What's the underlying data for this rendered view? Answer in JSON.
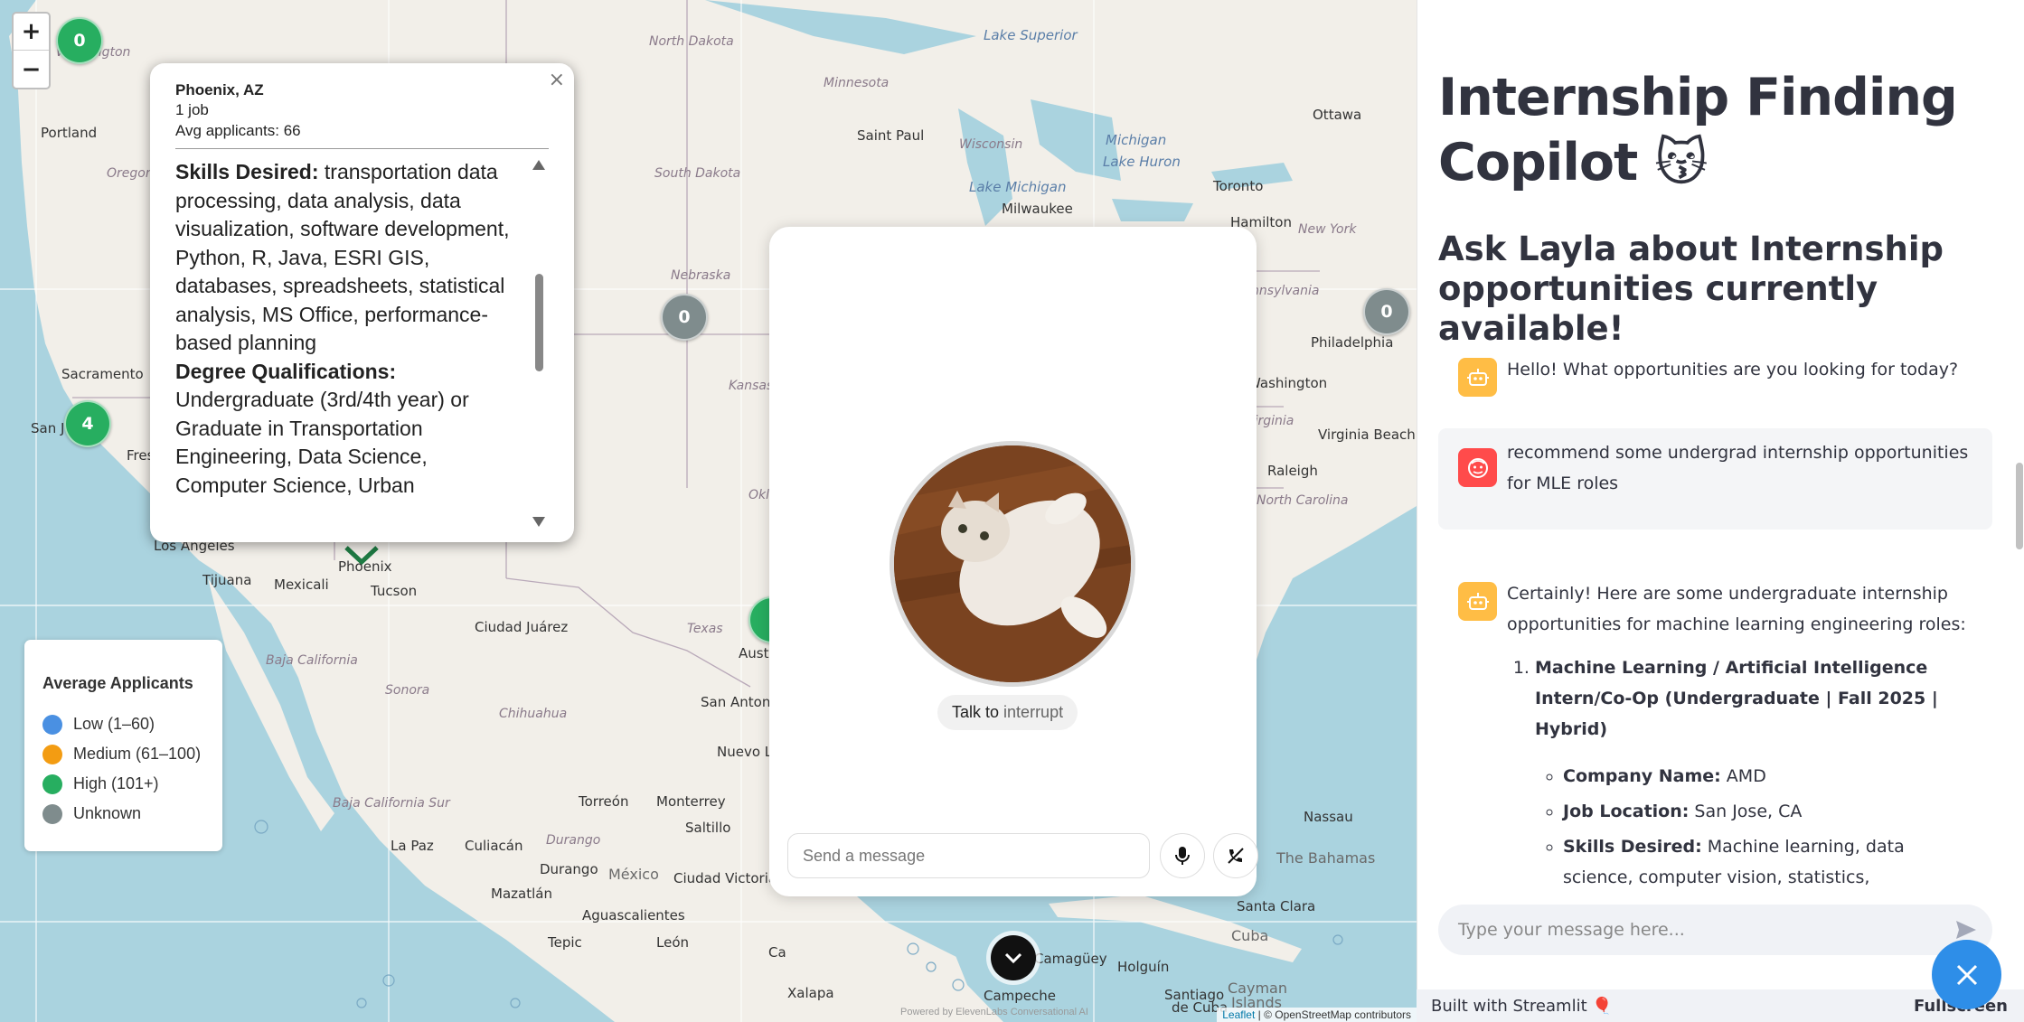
{
  "map": {
    "zoom_in": "+",
    "zoom_out": "−",
    "places": [
      {
        "name": "Washington",
        "cls": "state"
      },
      {
        "name": "North Dakota",
        "cls": "state"
      },
      {
        "name": "Lake Superior",
        "cls": "water"
      },
      {
        "name": "Minnesota",
        "cls": "state"
      },
      {
        "name": "Ottawa",
        "cls": ""
      },
      {
        "name": "Portland",
        "cls": ""
      },
      {
        "name": "Oregon",
        "cls": "state"
      },
      {
        "name": "Saint Paul",
        "cls": ""
      },
      {
        "name": "Wisconsin",
        "cls": "state"
      },
      {
        "name": "Michigan",
        "cls": "water"
      },
      {
        "name": "Lake Huron",
        "cls": "water"
      },
      {
        "name": "South Dakota",
        "cls": "state"
      },
      {
        "name": "Lake Michigan",
        "cls": "water"
      },
      {
        "name": "Toronto",
        "cls": ""
      },
      {
        "name": "Milwaukee",
        "cls": ""
      },
      {
        "name": "Hamilton",
        "cls": ""
      },
      {
        "name": "New York",
        "cls": "state"
      },
      {
        "name": "Nebraska",
        "cls": "state"
      },
      {
        "name": "Pennsylvania",
        "cls": "state"
      },
      {
        "name": "Philadelphia",
        "cls": ""
      },
      {
        "name": "Sacramento",
        "cls": ""
      },
      {
        "name": "Washington",
        "cls": ""
      },
      {
        "name": "Kansas",
        "cls": "state"
      },
      {
        "name": "San Jo",
        "cls": ""
      },
      {
        "name": "Fres",
        "cls": ""
      },
      {
        "name": "Virginia",
        "cls": "state"
      },
      {
        "name": "Virginia Beach",
        "cls": ""
      },
      {
        "name": "Raleigh",
        "cls": ""
      },
      {
        "name": "Okl",
        "cls": "state"
      },
      {
        "name": "North Carolina",
        "cls": "state"
      },
      {
        "name": "Los Angeles",
        "cls": ""
      },
      {
        "name": "Phoenix",
        "cls": ""
      },
      {
        "name": "Tijuana",
        "cls": ""
      },
      {
        "name": "Mexicali",
        "cls": ""
      },
      {
        "name": "Tucson",
        "cls": ""
      },
      {
        "name": "Ciudad Juárez",
        "cls": ""
      },
      {
        "name": "Texas",
        "cls": "state"
      },
      {
        "name": "Aust",
        "cls": ""
      },
      {
        "name": "Baja California",
        "cls": "state"
      },
      {
        "name": "Sonora",
        "cls": "state"
      },
      {
        "name": "San Antoni",
        "cls": ""
      },
      {
        "name": "Chihuahua",
        "cls": "state"
      },
      {
        "name": "Nuevo L",
        "cls": ""
      },
      {
        "name": "Baja California Sur",
        "cls": "state"
      },
      {
        "name": "Torreón",
        "cls": ""
      },
      {
        "name": "Monterrey",
        "cls": ""
      },
      {
        "name": "Nassau",
        "cls": ""
      },
      {
        "name": "La Paz",
        "cls": ""
      },
      {
        "name": "Culiacán",
        "cls": ""
      },
      {
        "name": "Durango",
        "cls": "state"
      },
      {
        "name": "Saltillo",
        "cls": ""
      },
      {
        "name": "The Bahamas",
        "cls": "country"
      },
      {
        "name": "Durango",
        "cls": ""
      },
      {
        "name": "México",
        "cls": "country"
      },
      {
        "name": "Ciudad Victoria",
        "cls": ""
      },
      {
        "name": "Mazatlán",
        "cls": ""
      },
      {
        "name": "Santa Clara",
        "cls": ""
      },
      {
        "name": "Aguascalientes",
        "cls": ""
      },
      {
        "name": "Cuba",
        "cls": "country"
      },
      {
        "name": "Tepic",
        "cls": ""
      },
      {
        "name": "León",
        "cls": ""
      },
      {
        "name": "Ca",
        "cls": ""
      },
      {
        "name": "Camagüey",
        "cls": ""
      },
      {
        "name": "Holguín",
        "cls": ""
      },
      {
        "name": "Cayman",
        "cls": "country"
      },
      {
        "name": "Islands",
        "cls": "country"
      },
      {
        "name": "Xalapa",
        "cls": ""
      },
      {
        "name": "Campeche",
        "cls": ""
      },
      {
        "name": "Santiago",
        "cls": ""
      },
      {
        "name": "de Cuba",
        "cls": ""
      }
    ],
    "clusters": [
      {
        "label": "0",
        "color": "green"
      },
      {
        "label": "0",
        "color": "gray"
      },
      {
        "label": "0",
        "color": "gray"
      },
      {
        "label": "4",
        "color": "green"
      }
    ],
    "phoenix_marker_label": "Phoenix",
    "attribution_leaflet": "Leaflet",
    "attribution_osm": "| © OpenStreetMap contributors"
  },
  "popup": {
    "close": "×",
    "city": "Phoenix, AZ",
    "jobs": "1 job",
    "avg": "Avg applicants: 66",
    "skills_label": "Skills Desired:",
    "skills": "transportation data processing, data analysis, data visualization, software development, Python, R, Java, ESRI GIS, databases, spreadsheets, statistical analysis, MS Office, performance-based planning",
    "degree_label": "Degree Qualifications:",
    "degree": "Undergraduate (3rd/4th year) or Graduate in Transportation Engineering, Data Science, Computer Science, Urban"
  },
  "legend": {
    "title": "Average Applicants",
    "items": [
      {
        "label": "Low (1–60)",
        "color": "#4a90e2"
      },
      {
        "label": "Medium (61–100)",
        "color": "#f39c12"
      },
      {
        "label": "High (101+)",
        "color": "#27ae60"
      },
      {
        "label": "Unknown",
        "color": "#7f8c8d"
      }
    ]
  },
  "voice": {
    "talk_prefix": "Talk to ",
    "talk_suffix": "interrupt",
    "input_placeholder": "Send a message",
    "powered": "Powered by ElevenLabs Conversational AI"
  },
  "panel": {
    "title": "Internship Finding Copilot 😽",
    "subtitle": "Ask Layla about Internship opportunities currently available!",
    "messages": [
      {
        "role": "assistant",
        "text": "Hello! What opportunities are you looking for today?"
      },
      {
        "role": "user",
        "text": "recommend some undergrad internship opportunities for MLE roles"
      },
      {
        "role": "assistant",
        "text": "Certainly! Here are some undergraduate internship opportunities for machine learning engineering roles:"
      }
    ],
    "job": {
      "title": "Machine Learning / Artificial Intelligence Intern/Co-Op (Undergraduate | Fall 2025 | Hybrid)",
      "company_label": "Company Name:",
      "company": "AMD",
      "location_label": "Job Location:",
      "location": "San Jose, CA",
      "skills_label": "Skills Desired:",
      "skills": "Machine learning, data science, computer vision, statistics, mathematics, Python, C/C++, SQL, NoSQL, PyTorch, TensorFlow, Caffe"
    },
    "input_placeholder": "Type your message here...",
    "footer_built": "Built with Streamlit 🎈",
    "footer_fullscreen": "Fullscreen"
  },
  "colors": {
    "accent_blue": "#2e8ee8",
    "cluster_green": "#27ae60",
    "cluster_gray": "#7f8c8d",
    "bot_avatar": "#ffbd45",
    "user_avatar": "#ff4b4b"
  }
}
